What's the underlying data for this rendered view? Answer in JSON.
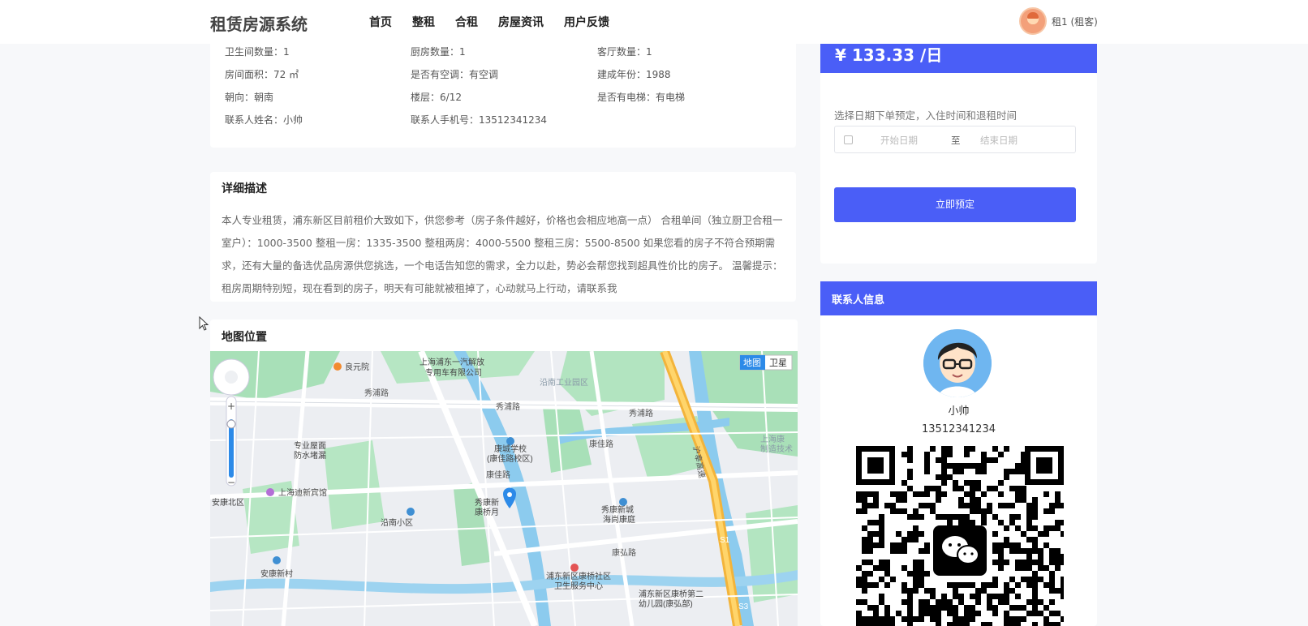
{
  "header": {
    "logo": "租赁房源系统",
    "nav": [
      "首页",
      "整租",
      "合租",
      "房屋资讯",
      "用户反馈"
    ],
    "user": "租1 (租客)"
  },
  "info": {
    "items": [
      {
        "k": "卫生间数量：",
        "v": "1"
      },
      {
        "k": "厨房数量：",
        "v": "1"
      },
      {
        "k": "客厅数量：",
        "v": "1"
      },
      {
        "k": "房间面积：",
        "v": "72 ㎡"
      },
      {
        "k": "是否有空调：",
        "v": "有空调"
      },
      {
        "k": "建成年份：",
        "v": "1988"
      },
      {
        "k": "朝向：",
        "v": "朝南"
      },
      {
        "k": "楼层：",
        "v": "6/12"
      },
      {
        "k": "是否有电梯：",
        "v": "有电梯"
      },
      {
        "k": "联系人姓名：",
        "v": "小帅"
      },
      {
        "k": "联系人手机号：",
        "v": "13512341234"
      }
    ]
  },
  "description": {
    "title": "详细描述",
    "text": "本人专业租赁，浦东新区目前租价大致如下，供您参考（房子条件越好，价格也会相应地高一点） 合租单间（独立厨卫合租一室户）：1000-3500 整租一房：1335-3500 整租两房：4000-5500 整租三房：5500-8500 如果您看的房子不符合预期需求，还有大量的备选优品房源供您挑选，一个电话告知您的需求，全力以赴，势必会帮您找到超具性价比的房子。 温馨提示：租房周期特别短，现在看到的房子，明天有可能就被租掉了，心动就马上行动，请联系我"
  },
  "map": {
    "title": "地图位置",
    "toggle": [
      "地图",
      "卫星"
    ],
    "labels": [
      "良元院",
      "上海浦东一汽解放",
      "专用车有限公司",
      "沿南工业园区",
      "秀浦路",
      "秀浦路",
      "秀浦路",
      "康城学校",
      "(康佳路校区)",
      "康佳路",
      "康佳路",
      "专业屋面",
      "防水堵漏",
      "上海迪新宾馆",
      "安康北区",
      "秀康新",
      "康桥月",
      "沿南小区",
      "秀康新城",
      "海尚康庭",
      "沪奉高速",
      "浦东新区康桥社区",
      "卫生服务中心",
      "安康新村",
      "浦东新区康桥第二",
      "幼儿园(康弘部)",
      "上海康",
      "制造技术",
      "S3",
      "康弘路",
      "S1"
    ]
  },
  "booking": {
    "price": "¥ 133.33 /日",
    "hint": "选择日期下单预定，入住时间和退租时间",
    "start_placeholder": "开始日期",
    "separator": "至",
    "end_placeholder": "结束日期",
    "button": "立即预定"
  },
  "contact": {
    "title": "联系人信息",
    "name": "小帅",
    "phone": "13512341234"
  },
  "colors": {
    "accent": "#4a5ef7"
  }
}
